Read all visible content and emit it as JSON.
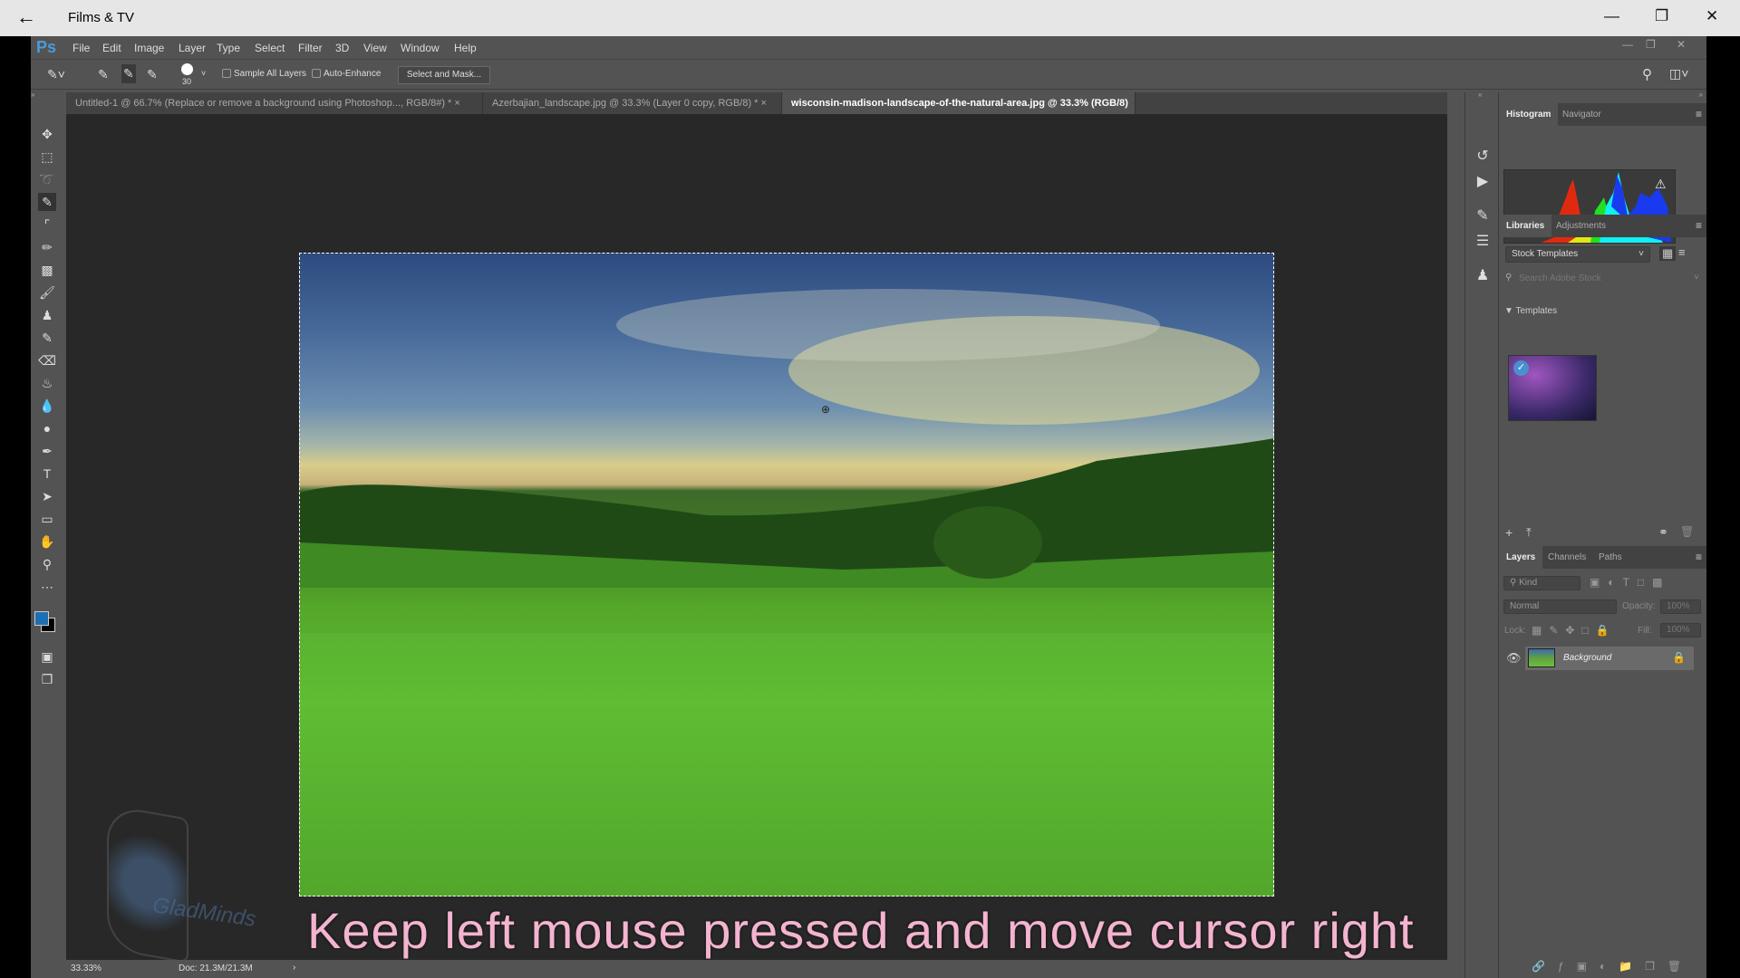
{
  "window": {
    "title": "Films & TV",
    "back_icon": "arrow-left-icon"
  },
  "menu": {
    "logo": "Ps",
    "items": [
      "File",
      "Edit",
      "Image",
      "Layer",
      "Type",
      "Select",
      "Filter",
      "3D",
      "View",
      "Window",
      "Help"
    ]
  },
  "options": {
    "brush_size": "30",
    "sample_all_layers": "Sample All Layers",
    "auto_enhance": "Auto-Enhance",
    "select_and_mask": "Select and Mask...",
    "sample_all_checked": false,
    "auto_enhance_checked": false
  },
  "tabs": [
    {
      "label": "Untitled-1 @ 66.7% (Replace or remove a  background using Photoshop..., RGB/8#) *",
      "active": false
    },
    {
      "label": "Azerbajian_landscape.jpg @ 33.3% (Layer 0 copy, RGB/8) *",
      "active": false
    },
    {
      "label": "wisconsin-madison-landscape-of-the-natural-area.jpg @ 33.3% (RGB/8)",
      "active": true
    }
  ],
  "caption": "Keep left mouse pressed and move cursor right",
  "watermark": "GladMinds",
  "status": {
    "zoom": "33.33%",
    "doc": "Doc: 21.3M/21.3M"
  },
  "panels": {
    "histogram_tabs": [
      "Histogram",
      "Navigator"
    ],
    "libraries_tabs": [
      "Libraries",
      "Adjustments"
    ],
    "library_select": "Stock Templates",
    "search_placeholder": "Search Adobe Stock",
    "templates_header": "Templates",
    "layers_tabs": [
      "Layers",
      "Channels",
      "Paths"
    ],
    "kind": "Kind",
    "blend_mode": "Normal",
    "opacity_label": "Opacity:",
    "opacity": "100%",
    "lock_label": "Lock:",
    "fill_label": "Fill:",
    "fill": "100%",
    "layer_name": "Background"
  },
  "colors": {
    "foreground": "#1c6fb0",
    "background": "#000000",
    "accent": "#4a9bd8"
  }
}
